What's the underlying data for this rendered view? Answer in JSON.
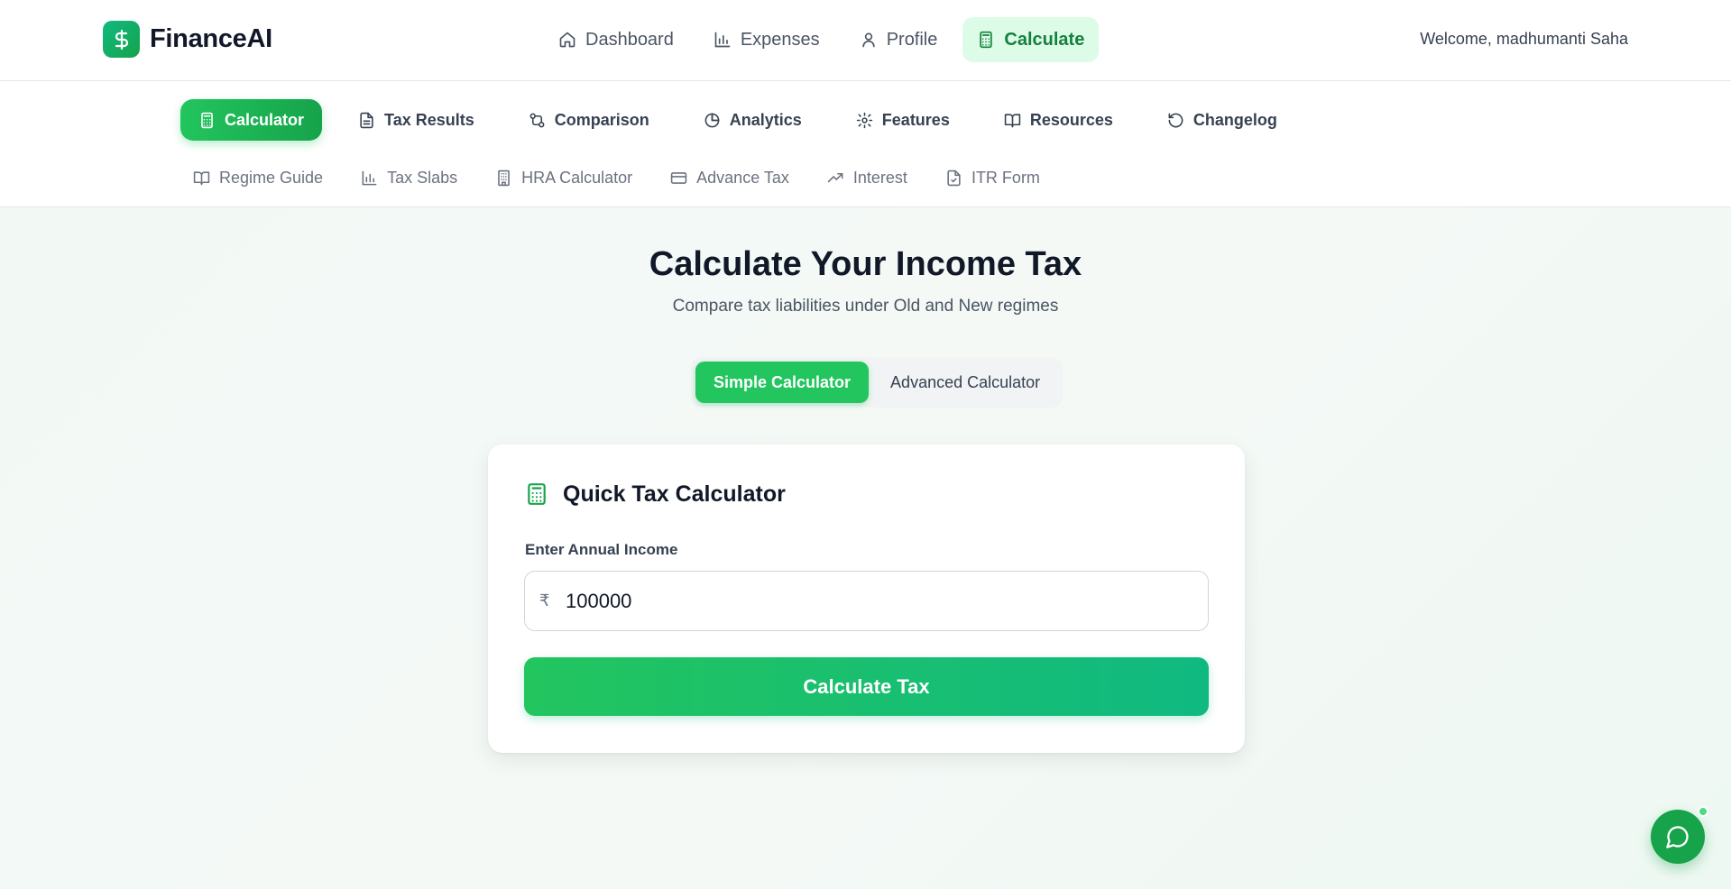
{
  "brand": {
    "name": "FinanceAI",
    "logo_icon": "dollar-icon"
  },
  "main_nav": [
    {
      "label": "Dashboard",
      "icon": "home-icon",
      "active": false
    },
    {
      "label": "Expenses",
      "icon": "bar-chart-icon",
      "active": false
    },
    {
      "label": "Profile",
      "icon": "user-icon",
      "active": false
    },
    {
      "label": "Calculate",
      "icon": "calculator-icon",
      "active": true
    }
  ],
  "welcome_text": "Welcome, madhumanti Saha",
  "sub_nav": [
    {
      "label": "Calculator",
      "icon": "calculator-icon",
      "active": true
    },
    {
      "label": "Tax Results",
      "icon": "document-icon",
      "active": false
    },
    {
      "label": "Comparison",
      "icon": "compare-icon",
      "active": false
    },
    {
      "label": "Analytics",
      "icon": "pie-chart-icon",
      "active": false
    },
    {
      "label": "Features",
      "icon": "gear-icon",
      "active": false
    },
    {
      "label": "Resources",
      "icon": "book-icon",
      "active": false
    },
    {
      "label": "Changelog",
      "icon": "history-icon",
      "active": false
    }
  ],
  "tools_nav": [
    {
      "label": "Regime Guide",
      "icon": "book-open-icon"
    },
    {
      "label": "Tax Slabs",
      "icon": "bar-chart-icon"
    },
    {
      "label": "HRA Calculator",
      "icon": "building-icon"
    },
    {
      "label": "Advance Tax",
      "icon": "credit-card-icon"
    },
    {
      "label": "Interest",
      "icon": "trending-up-icon"
    },
    {
      "label": "ITR Form",
      "icon": "file-check-icon"
    }
  ],
  "hero": {
    "title": "Calculate Your Income Tax",
    "subtitle": "Compare tax liabilities under Old and New regimes"
  },
  "mode_toggle": {
    "simple_label": "Simple Calculator",
    "advanced_label": "Advanced Calculator",
    "selected": "simple"
  },
  "calculator_card": {
    "title": "Quick Tax Calculator",
    "income_label": "Enter Annual Income",
    "currency_symbol": "₹",
    "income_value": "100000",
    "submit_label": "Calculate Tax"
  },
  "colors": {
    "accent": "#22c55e",
    "accent_dark": "#16a34a",
    "active_nav_bg": "#dcfce7",
    "active_nav_text": "#15803d"
  }
}
